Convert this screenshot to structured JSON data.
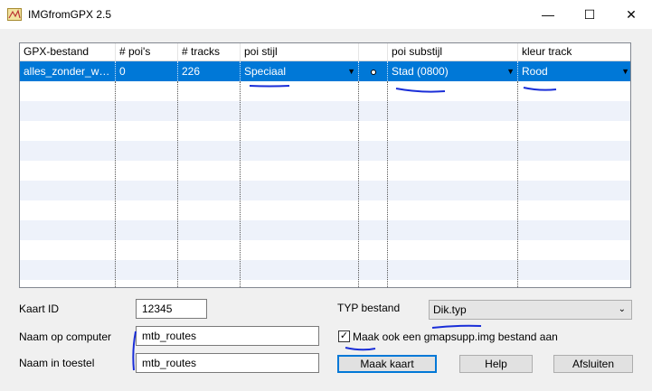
{
  "window": {
    "title": "IMGfromGPX 2.5",
    "minimize_glyph": "—",
    "maximize_glyph": "☐",
    "close_glyph": "✕"
  },
  "table": {
    "columns": [
      "GPX-bestand",
      "# poi's",
      "# tracks",
      "poi stijl",
      "",
      "poi substijl",
      "kleur track"
    ],
    "selected_row": {
      "gpx_file": "alles_zonder_way...",
      "poi_count": "0",
      "track_count": "226",
      "poi_style": "Speciaal",
      "poi_substyle": "Stad (0800)",
      "track_color": "Rood"
    },
    "empty_rows": 11
  },
  "form": {
    "kaart_id_label": "Kaart ID",
    "kaart_id_value": "12345",
    "naam_computer_label": "Naam op computer",
    "naam_computer_value": "mtb_routes",
    "naam_toestel_label": "Naam in toestel",
    "naam_toestel_value": "mtb_routes",
    "typ_label": "TYP bestand",
    "typ_value": "Dik.typ",
    "gmapsupp_label": "Maak ook een gmapsupp.img bestand aan",
    "gmapsupp_checked": true
  },
  "buttons": {
    "maak_kaart": "Maak kaart",
    "help": "Help",
    "afsluiten": "Afsluiten"
  },
  "colors": {
    "selection": "#0078d7",
    "annotation": "#1a2ed8"
  }
}
